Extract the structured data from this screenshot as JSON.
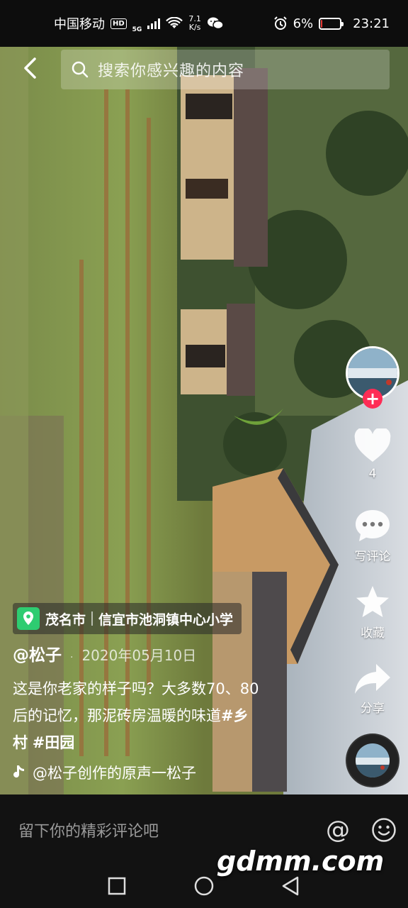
{
  "status_bar": {
    "carrier": "中国移动",
    "hd": "HD",
    "network": "5G",
    "net_speed_value": "7.1",
    "net_speed_unit": "K/s",
    "battery_percent": "6%",
    "battery_level": 0.06,
    "time": "23:21",
    "icons": [
      "wifi-icon",
      "wechat-icon",
      "alarm-icon",
      "battery-icon"
    ]
  },
  "search": {
    "placeholder": "搜索你感兴趣的内容"
  },
  "rail": {
    "like_count": "4",
    "comment_label": "写评论",
    "favorite_label": "收藏",
    "share_label": "分享"
  },
  "location": {
    "city": "茂名市",
    "place": "信宜市池洞镇中心小学"
  },
  "post": {
    "author": "@松子",
    "dot": "·",
    "date": "2020年05月10日",
    "caption_line1": "这是你老家的样子吗？大多数70、80",
    "caption_line2a": "后的记忆，那泥砖房温暖的味道",
    "caption_tag1_a": "#乡",
    "caption_tag1_b": "村",
    "caption_tag2": "#田园",
    "music": "@松子创作的原声一松子"
  },
  "comment_bar": {
    "placeholder": "留下你的精彩评论吧",
    "at_symbol": "@"
  },
  "watermark": "gdmm.com",
  "colors": {
    "accent_red": "#fe2c55",
    "location_green": "#2ecc71",
    "battery_low": "#e53935"
  }
}
